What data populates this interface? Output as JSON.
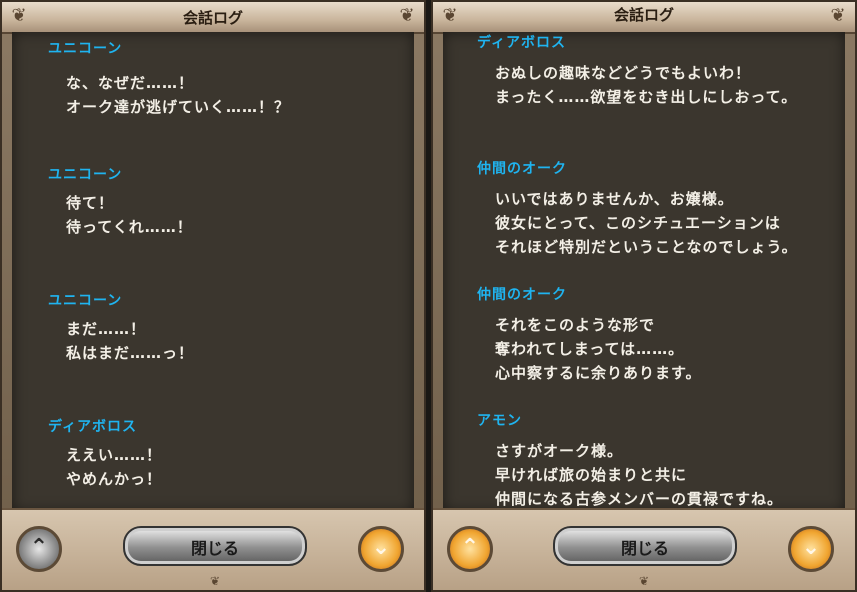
{
  "window_title": "会話ログ",
  "close_label": "閉じる",
  "icons": {
    "scroll_up": "chevron-up-icon",
    "scroll_down": "chevron-down-icon",
    "ornament": "filigree-ornament-icon"
  },
  "colors": {
    "speaker": "#1fb4f0",
    "text": "#f3efe6",
    "log_bg": "#3b362e"
  },
  "left_panel": {
    "entries": [
      {
        "speaker": "ユニコーン",
        "lines": [
          "な、なぜだ……！",
          "オーク達が逃げていく……！？"
        ]
      },
      {
        "speaker": "ユニコーン",
        "lines": [
          "待て！",
          "待ってくれ……！"
        ]
      },
      {
        "speaker": "ユニコーン",
        "lines": [
          "まだ……！",
          "私はまだ……っ！"
        ]
      },
      {
        "speaker": "ディアボロス",
        "lines": [
          "ええい……！",
          "やめんかっ！"
        ]
      }
    ]
  },
  "right_panel": {
    "entries": [
      {
        "speaker": "ディアボロス",
        "lines": [
          "おぬしの趣味などどうでもよいわ！",
          "まったく……欲望をむき出しにしおって。"
        ]
      },
      {
        "speaker": "仲間のオーク",
        "lines": [
          "いいではありませんか、お嬢様。",
          "彼女にとって、このシチュエーションは",
          "それほど特別だということなのでしょう。"
        ]
      },
      {
        "speaker": "仲間のオーク",
        "lines": [
          "それをこのような形で",
          "奪われてしまっては……。",
          "心中察するに余りあります。"
        ]
      },
      {
        "speaker": "アモン",
        "lines": [
          "さすがオーク様。",
          "早ければ旅の始まりと共に",
          "仲間になる古参メンバーの貫禄ですね。"
        ]
      }
    ]
  }
}
